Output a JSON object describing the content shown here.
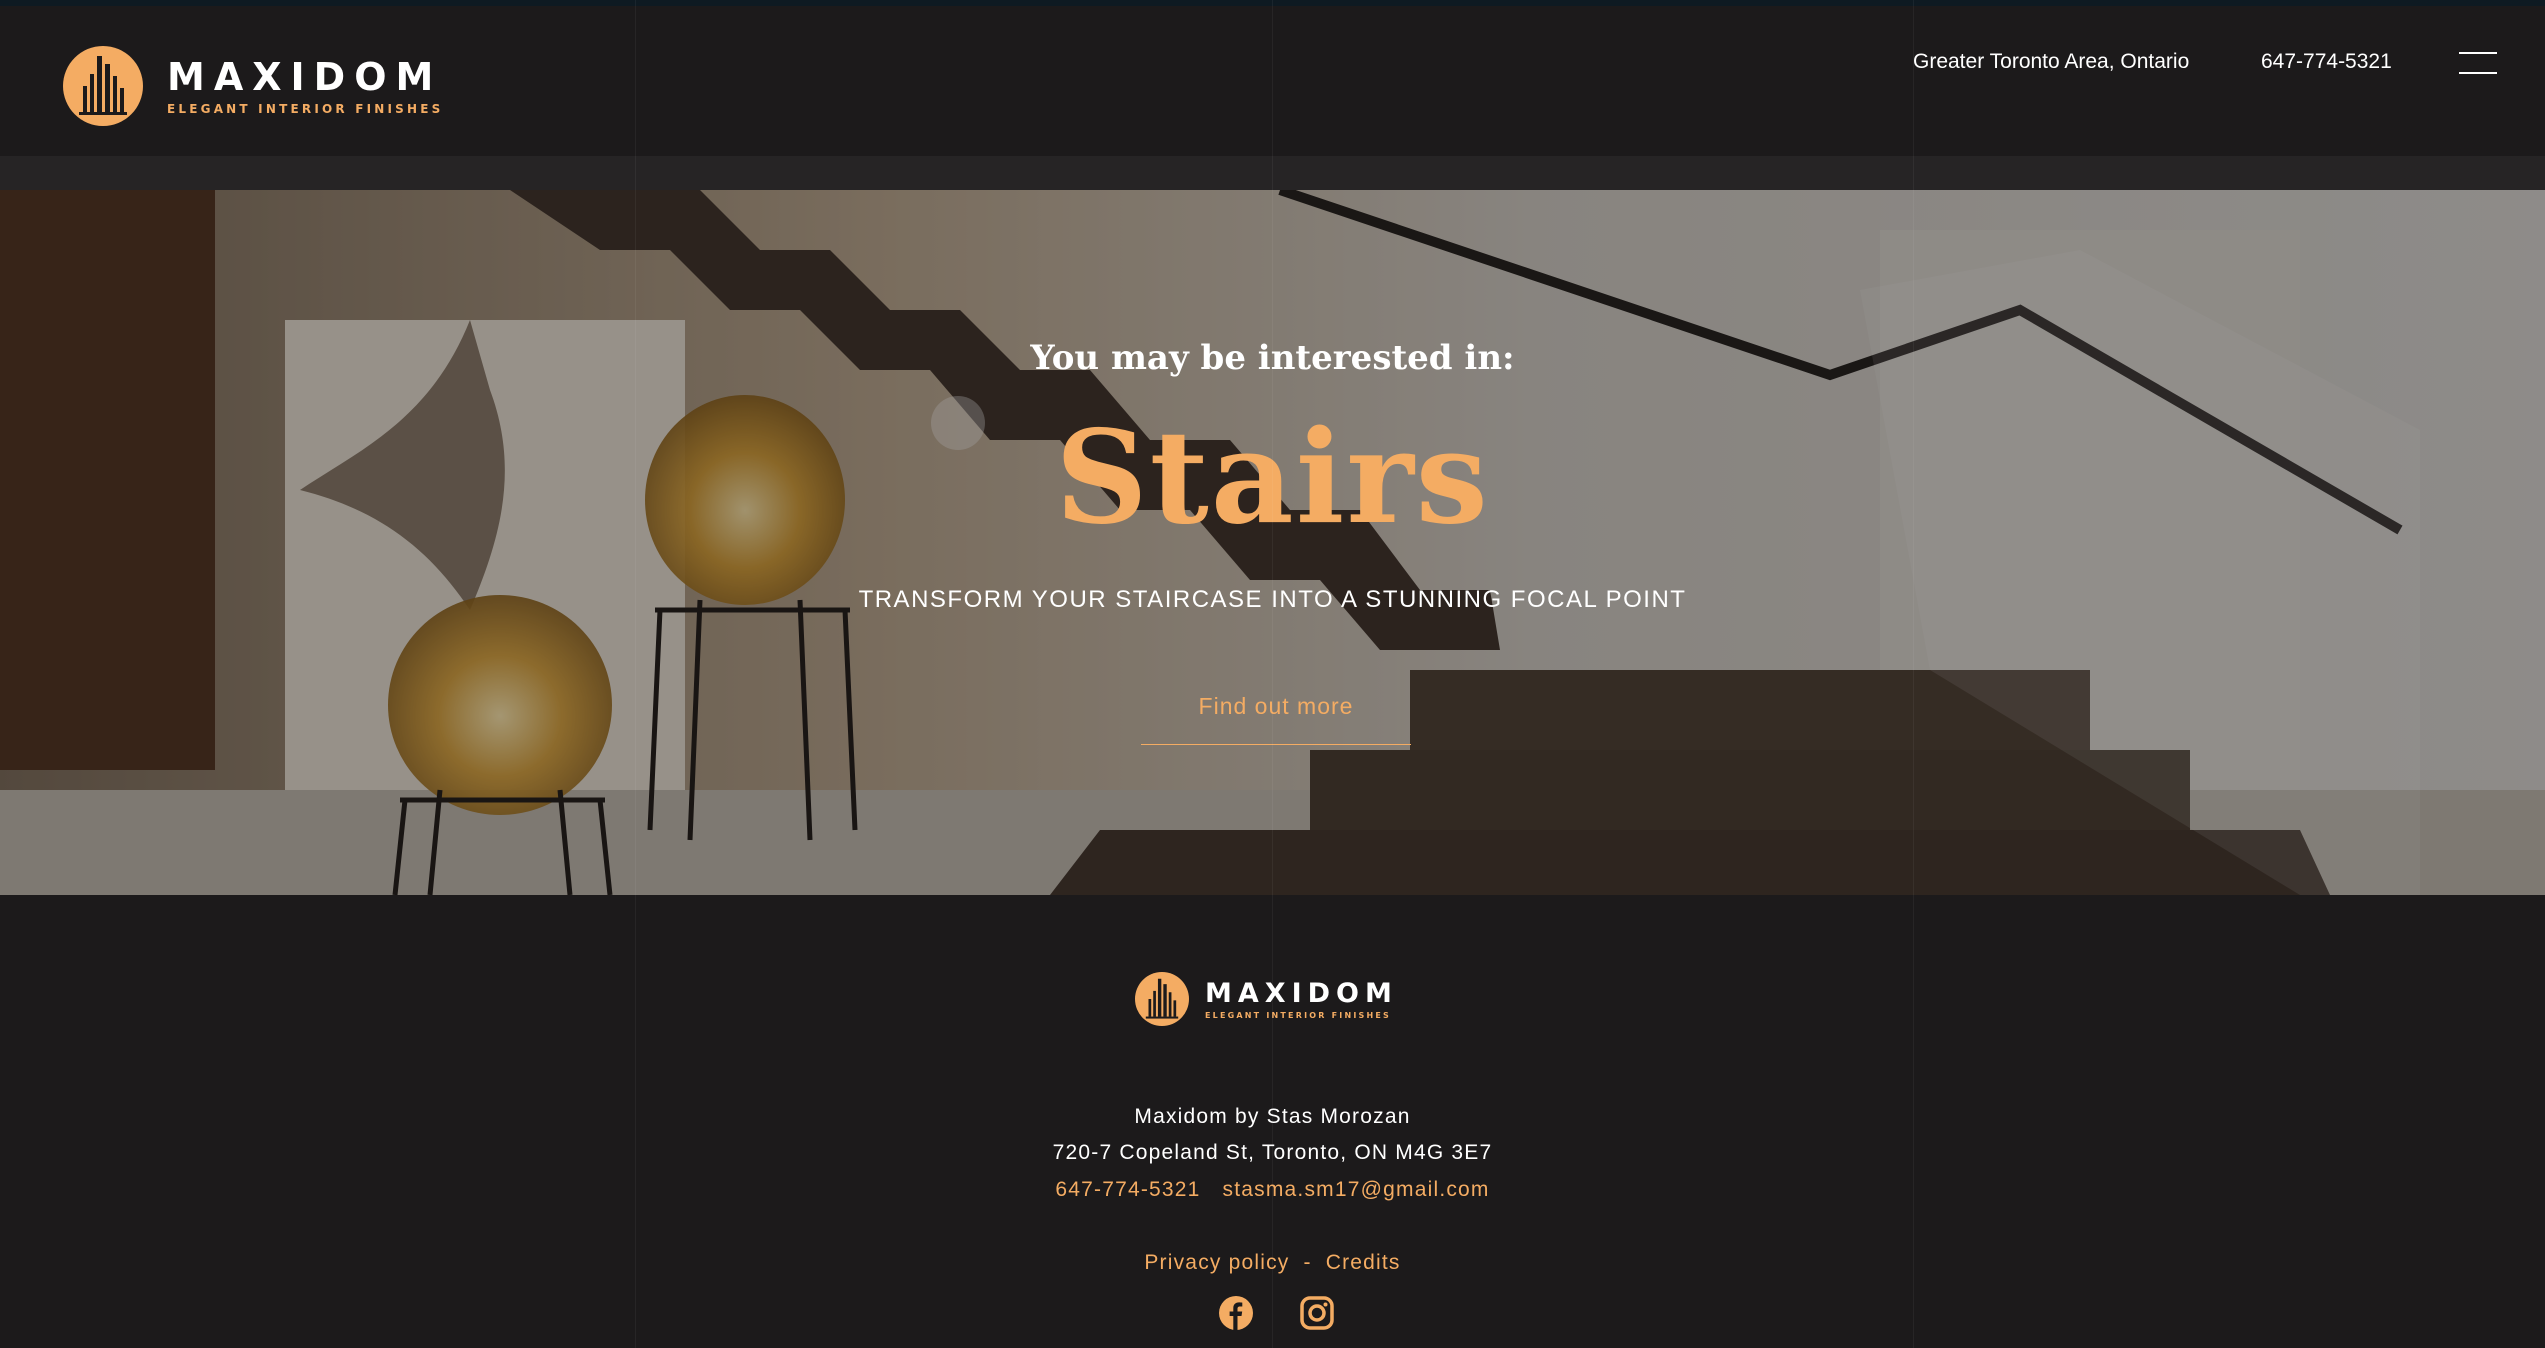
{
  "brand": {
    "name": "MAXIDOM",
    "tagline": "ELEGANT INTERIOR FINISHES",
    "accent_color": "#f4ac63",
    "background_color": "#1c1a1b"
  },
  "header": {
    "location": "Greater Toronto Area, Ontario",
    "phone": "647-774-5321",
    "menu_icon": "hamburger-icon"
  },
  "hero": {
    "kicker": "You may be interested in:",
    "title": "Stairs",
    "subtitle": "TRANSFORM YOUR STAIRCASE INTO A STUNNING FOCAL POINT",
    "cta_label": "Find out more",
    "image": "staircase-photo"
  },
  "footer": {
    "company": "Maxidom by Stas Morozan",
    "address": "720-7 Copeland St, Toronto, ON M4G 3E7",
    "phone": "647-774-5321",
    "email": "stasma.sm17@gmail.com",
    "privacy_label": "Privacy policy",
    "separator": "-",
    "credits_label": "Credits",
    "social": [
      "facebook-icon",
      "instagram-icon"
    ]
  }
}
